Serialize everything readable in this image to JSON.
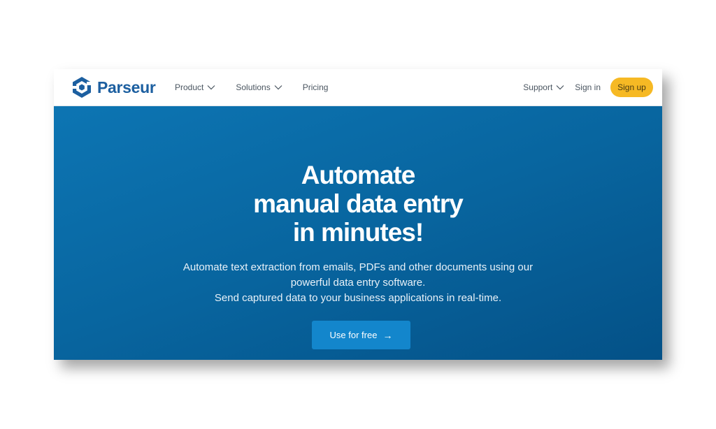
{
  "brand": {
    "name": "Parseur",
    "logo_icon": "parseur-hexagon-logo",
    "color": "#1c5fa0"
  },
  "nav": {
    "product_label": "Product",
    "solutions_label": "Solutions",
    "pricing_label": "Pricing",
    "support_label": "Support",
    "signin_label": "Sign in",
    "signup_label": "Sign up",
    "signup_color": "#f6b924"
  },
  "hero": {
    "headline_lines": [
      "Automate",
      "manual data entry",
      "in minutes!"
    ],
    "subtitle_lines": [
      "Automate text extraction from emails, PDFs and other documents using our",
      "powerful data entry software.",
      "Send captured data to your business applications in real-time."
    ],
    "cta_label": "Use for free",
    "cta_arrow": "→",
    "background_color": "#0a6aa7",
    "cta_color": "#1386cc"
  }
}
